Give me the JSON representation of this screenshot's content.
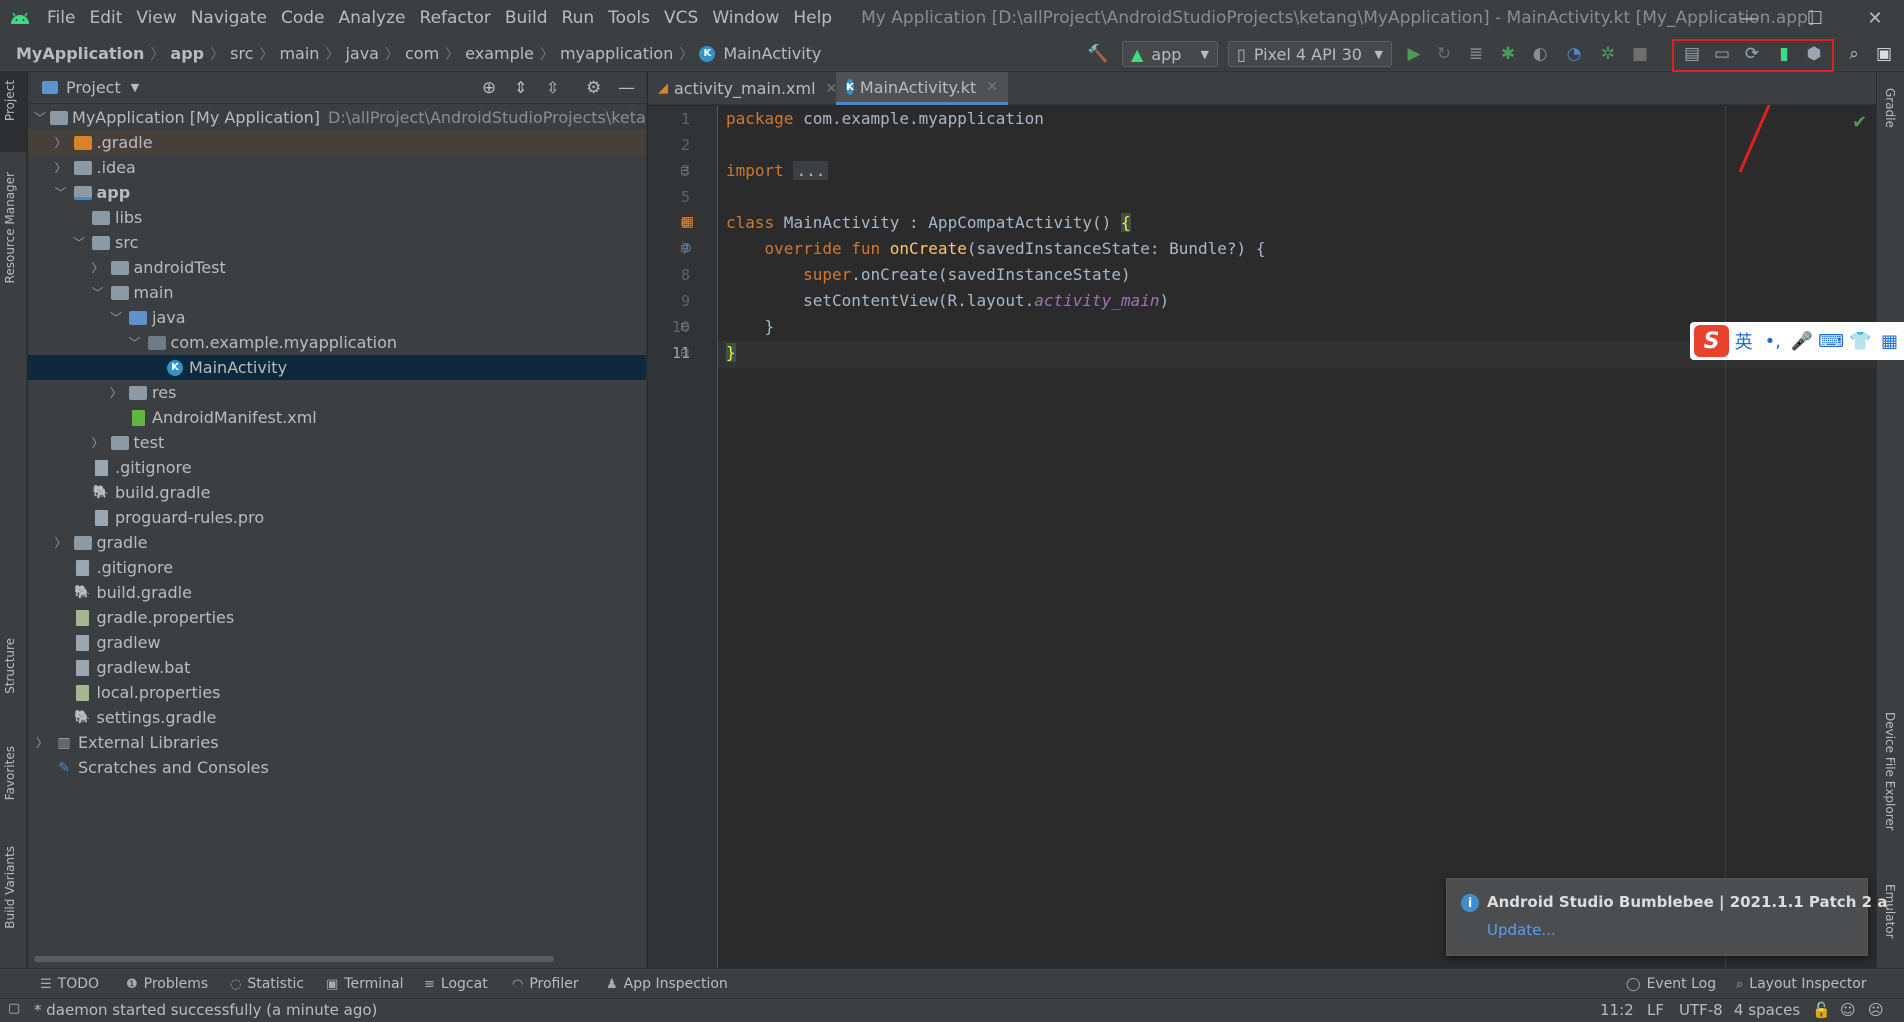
{
  "menubar": {
    "items": [
      "File",
      "Edit",
      "View",
      "Navigate",
      "Code",
      "Analyze",
      "Refactor",
      "Build",
      "Run",
      "Tools",
      "VCS",
      "Window",
      "Help"
    ],
    "window_title": "My Application [D:\\allProject\\AndroidStudioProjects\\ketang\\MyApplication] - MainActivity.kt [My_Application.app]"
  },
  "navbar": {
    "breadcrumbs": [
      "MyApplication",
      "app",
      "src",
      "main",
      "java",
      "com",
      "example",
      "myapplication",
      "MainActivity"
    ],
    "run_config": "app",
    "device": "Pixel 4 API 30"
  },
  "left_strip": {
    "tabs": [
      "Project",
      "Resource Manager",
      "Structure",
      "Favorites",
      "Build Variants"
    ]
  },
  "right_strip": {
    "tabs": [
      "Gradle",
      "Device File Explorer",
      "Emulator"
    ]
  },
  "project_panel": {
    "header": "Project",
    "tree": [
      {
        "label": "MyApplication [My Application]",
        "hint": "D:\\allProject\\AndroidStudioProjects\\ketang\\",
        "depth": 0,
        "expanded": true,
        "icon": "folder"
      },
      {
        "label": ".gradle",
        "depth": 1,
        "expanded": false,
        "icon": "folder-orange"
      },
      {
        "label": ".idea",
        "depth": 1,
        "expanded": false,
        "icon": "folder"
      },
      {
        "label": "app",
        "depth": 1,
        "expanded": true,
        "icon": "folder-module"
      },
      {
        "label": "libs",
        "depth": 2,
        "icon": "folder"
      },
      {
        "label": "src",
        "depth": 2,
        "expanded": true,
        "icon": "folder"
      },
      {
        "label": "androidTest",
        "depth": 3,
        "expanded": false,
        "icon": "folder"
      },
      {
        "label": "main",
        "depth": 3,
        "expanded": true,
        "icon": "folder"
      },
      {
        "label": "java",
        "depth": 4,
        "expanded": true,
        "icon": "folder-blue"
      },
      {
        "label": "com.example.myapplication",
        "depth": 5,
        "expanded": true,
        "icon": "package"
      },
      {
        "label": "MainActivity",
        "depth": 6,
        "icon": "kotlin"
      },
      {
        "label": "res",
        "depth": 4,
        "expanded": false,
        "icon": "folder"
      },
      {
        "label": "AndroidManifest.xml",
        "depth": 4,
        "icon": "xml"
      },
      {
        "label": "test",
        "depth": 3,
        "expanded": false,
        "icon": "folder"
      },
      {
        "label": ".gitignore",
        "depth": 2,
        "icon": "file"
      },
      {
        "label": "build.gradle",
        "depth": 2,
        "icon": "gradle"
      },
      {
        "label": "proguard-rules.pro",
        "depth": 2,
        "icon": "file"
      },
      {
        "label": "gradle",
        "depth": 1,
        "expanded": false,
        "icon": "folder"
      },
      {
        "label": ".gitignore",
        "depth": 1,
        "icon": "file"
      },
      {
        "label": "build.gradle",
        "depth": 1,
        "icon": "gradle"
      },
      {
        "label": "gradle.properties",
        "depth": 1,
        "icon": "properties"
      },
      {
        "label": "gradlew",
        "depth": 1,
        "icon": "file"
      },
      {
        "label": "gradlew.bat",
        "depth": 1,
        "icon": "file"
      },
      {
        "label": "local.properties",
        "depth": 1,
        "icon": "properties"
      },
      {
        "label": "settings.gradle",
        "depth": 1,
        "icon": "gradle"
      },
      {
        "label": "External Libraries",
        "depth": 0,
        "expanded": false,
        "icon": "libraries"
      },
      {
        "label": "Scratches and Consoles",
        "depth": 0,
        "icon": "scratches"
      }
    ]
  },
  "editor": {
    "tabs": [
      {
        "label": "activity_main.xml",
        "active": false
      },
      {
        "label": "MainActivity.kt",
        "active": true
      }
    ],
    "line_numbers": [
      "1",
      "2",
      "3",
      "5",
      "6",
      "7",
      "8",
      "9",
      "10",
      "11"
    ],
    "code": {
      "l1_kw": "package",
      "l1_rest": " com.example.myapplication",
      "l3_kw": "import",
      "l3_fold": "...",
      "l6_kw": "class",
      "l6_rest": " MainActivity : AppCompatActivity() ",
      "l6_brace": "{",
      "l7_kw": "override fun",
      "l7_fn": "onCreate",
      "l7_rest": "(savedInstanceState: Bundle?) {",
      "l8_kw": "super",
      "l8_rest": ".onCreate(savedInstanceState)",
      "l9_rest": "setContentView(R.layout.",
      "l9_it": "activity_main",
      "l9_close": ")",
      "l10": "}",
      "l11": "}"
    }
  },
  "ime": {
    "logo": "S",
    "items": [
      "英",
      "•,",
      "🎤",
      "⌨",
      "👕",
      "▦"
    ]
  },
  "notification": {
    "title": "Android Studio Bumblebee | 2021.1.1 Patch 2 a",
    "link": "Update..."
  },
  "bottom_tabs": [
    "TODO",
    "Problems",
    "Statistic",
    "Terminal",
    "Logcat",
    "Profiler",
    "App Inspection",
    "Event Log",
    "Layout Inspector"
  ],
  "status_bar": {
    "message": "* daemon started successfully (a minute ago)",
    "position": "11:2",
    "line_sep": "LF",
    "encoding": "UTF-8",
    "indent": "4 spaces"
  },
  "colors": {
    "accent": "#4a88c7",
    "highlight_box": "#e02020",
    "android_green": "#3ddc84"
  }
}
